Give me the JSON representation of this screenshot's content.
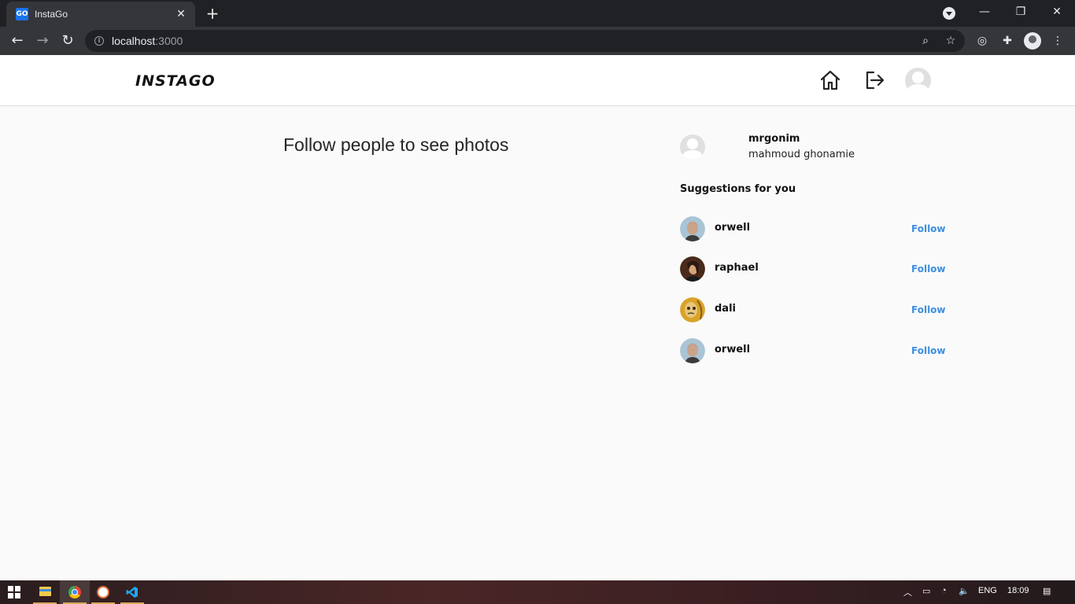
{
  "browser": {
    "tab_title": "InstaGo",
    "tab_favicon_text": "GO",
    "url_host": "localhost",
    "url_rest": ":3000"
  },
  "app": {
    "logo": "INSTAGO",
    "empty_feed_message": "Follow people to see photos",
    "current_user": {
      "username": "mrgonim",
      "full_name": "mahmoud ghonamie"
    },
    "suggestions_title": "Suggestions for you",
    "suggestions": [
      {
        "username": "orwell",
        "follow_label": "Follow",
        "avatar_color": "#a9c4d6"
      },
      {
        "username": "raphael",
        "follow_label": "Follow",
        "avatar_color": "#5a3422"
      },
      {
        "username": "dali",
        "follow_label": "Follow",
        "avatar_color": "#d9a32a"
      },
      {
        "username": "orwell",
        "follow_label": "Follow",
        "avatar_color": "#a9c4d6"
      }
    ]
  },
  "taskbar": {
    "language": "ENG",
    "time": "18:09"
  },
  "colors": {
    "follow_link": "#3d8fe0",
    "page_background": "#fafafa"
  }
}
